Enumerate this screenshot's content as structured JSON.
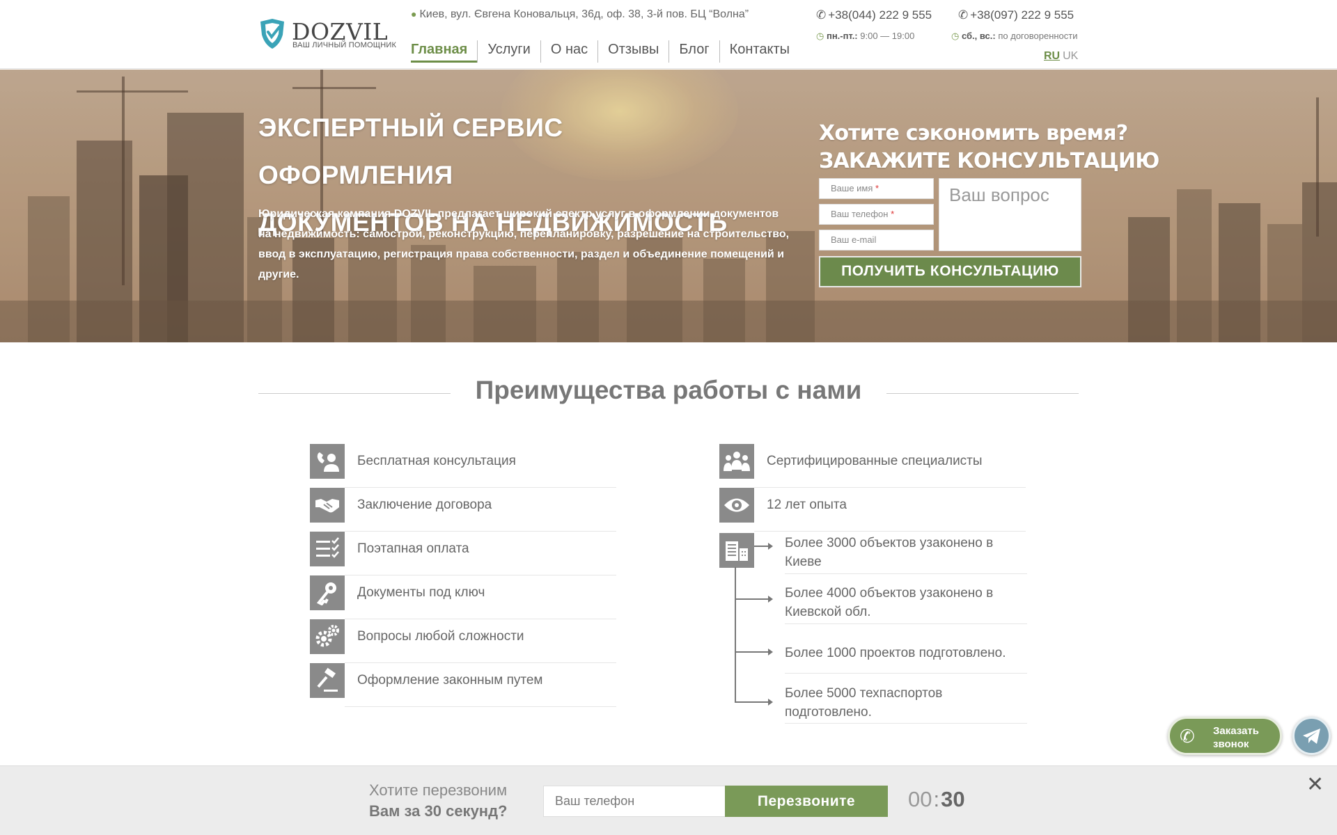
{
  "header": {
    "logo_text": "DOZVIL",
    "logo_tagline": "ВАШ ЛИЧНЫЙ ПОМОЩНИК",
    "address": "Киев, вул. Євгена Коновальця, 36д, оф. 38, 3-й пов. БЦ “Волна”",
    "nav": [
      "Главная",
      "Услуги",
      "О нас",
      "Отзывы",
      "Блог",
      "Контакты"
    ],
    "phone1": "+38(044) 222 9 555",
    "phone2": "+38(097) 222 9 555",
    "hours1_label": "пн.-пт.:",
    "hours1_value": "9:00 — 19:00",
    "hours2_label": "сб., вс.:",
    "hours2_value": "по договоренности",
    "lang_ru": "RU",
    "lang_uk": "UK"
  },
  "hero": {
    "title_line1": "ЭКСПЕРТНЫЙ СЕРВИС ОФОРМЛЕНИЯ",
    "title_line2": "ДОКУМЕНТОВ НА НЕДВИЖИМОСТЬ",
    "text": "Юридическая компания DOZVIL предлагает широкий спектр услуг в оформлении документов на недвижимость: самострой, реконструкцию, перепланировку, разрешение на строительство, ввод в эксплуатацию, регистрация права собственности, раздел и объединение помещений и другие.",
    "form_title1": "Хотите сэкономить время?",
    "form_title2": "ЗАКАЖИТЕ КОНСУЛЬТАЦИЮ",
    "name_placeholder": "Ваше имя",
    "phone_placeholder": "Ваш телефон",
    "email_placeholder": "Ваш e-mail",
    "question_placeholder": "Ваш вопрос",
    "required_mark": "*",
    "submit_label": "ПОЛУЧИТЬ КОНСУЛЬТАЦИЮ"
  },
  "advantages": {
    "title": "Преимущества работы с нами",
    "left": [
      {
        "label": "Бесплатная консультация",
        "icon": "consultation-icon"
      },
      {
        "label": "Заключение договора",
        "icon": "handshake-icon"
      },
      {
        "label": "Поэтапная оплата",
        "icon": "checklist-icon"
      },
      {
        "label": "Документы под ключ",
        "icon": "key-icon"
      },
      {
        "label": "Вопросы любой сложности",
        "icon": "gears-icon"
      },
      {
        "label": "Оформление законным путем",
        "icon": "gavel-icon"
      }
    ],
    "right": [
      {
        "label": "Сертифицированные специалисты",
        "icon": "people-icon"
      },
      {
        "label": "12 лет опыта",
        "icon": "eye-icon"
      }
    ],
    "stats_icon": "buildings-icon",
    "stats": [
      "Более 3000 объектов узаконено в Киеве",
      "Более 4000 объектов узаконено в Киевской обл.",
      "Более 1000 проектов подготовлено.",
      "Более 5000 техпаспортов подготовлено."
    ]
  },
  "floating": {
    "call_label1": "Заказать",
    "call_label2": "звонок",
    "call_icon": "phone-icon",
    "telegram_icon": "telegram-icon"
  },
  "callback_bar": {
    "question1": "Хотите перезвоним",
    "question2": "Вам за 30 секунд?",
    "phone_placeholder": "Ваш телефон",
    "button_label": "Перезвоните",
    "timer_min": "00",
    "timer_sep": ":",
    "timer_sec": "30",
    "close_icon": "close-icon"
  },
  "colors": {
    "accent_green": "#6c8a4c",
    "icon_gray": "#8a8a8a",
    "telegram_blue": "#7a9fb1"
  }
}
